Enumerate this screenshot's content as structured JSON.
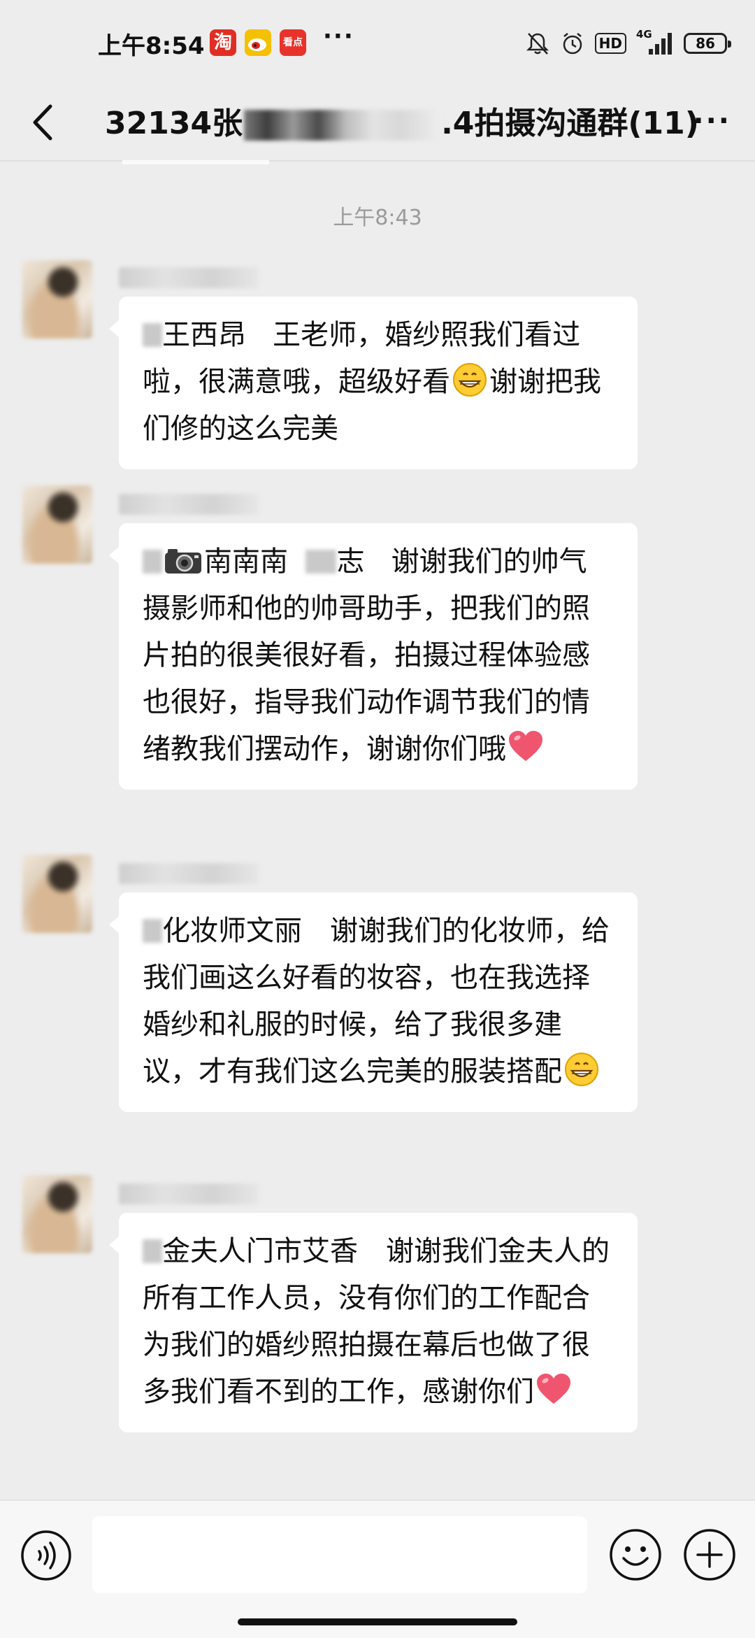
{
  "status_bar": {
    "time": "上午8:54",
    "apps": [
      {
        "name": "淘",
        "color": "#e02e24"
      },
      {
        "name": "weibo",
        "color": "#f5c000"
      },
      {
        "name": "看点",
        "color": "#e8322c"
      }
    ],
    "more": "···",
    "hd": "HD",
    "network": "4G",
    "battery": "86"
  },
  "header": {
    "title_prefix": "32134张",
    "title_suffix": ".4拍摄沟通群(11)",
    "more": "···"
  },
  "chat": {
    "time": "上午8:43",
    "messages": [
      {
        "name_part1": "王西昂",
        "name_part2": "王老师，婚纱照我们看过啦，很满意哦，超级好看",
        "after_emoji": "谢谢把我们修的这么完美"
      },
      {
        "name_part1": "南南南",
        "name_part2": "志",
        "text": "谢谢我们的帅气摄影师和他的帅哥助手，把我们的照片拍的很美很好看，拍摄过程体验感也很好，指导我们动作调节我们的情绪教我们摆动作，谢谢你们哦"
      },
      {
        "text": "化妆师文丽　谢谢我们的化妆师，给我们画这么好看的妆容，也在我选择婚纱和礼服的时候，给了我很多建议，才有我们这么完美的服装搭配"
      },
      {
        "text": "金夫人门市艾香　谢谢我们金夫人的所有工作人员，没有你们的工作配合为我们的婚纱照拍摄在幕后也做了很多我们看不到的工作，感谢你们"
      }
    ]
  },
  "input_bar": {
    "placeholder": ""
  }
}
